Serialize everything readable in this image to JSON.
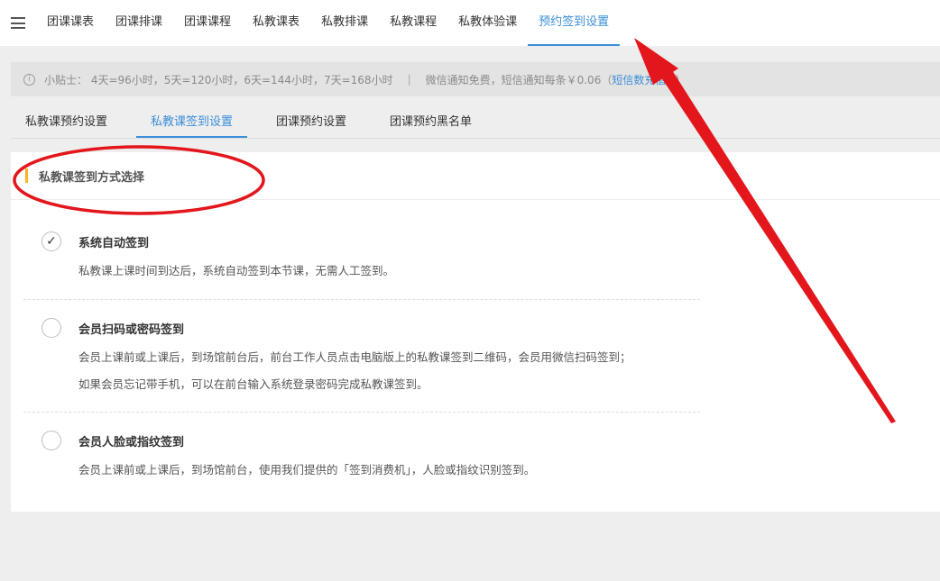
{
  "topnav": {
    "menu_icon": "hamburger-menu-icon",
    "tabs": [
      {
        "label": "团课课表"
      },
      {
        "label": "团课排课"
      },
      {
        "label": "团课课程"
      },
      {
        "label": "私教课表"
      },
      {
        "label": "私教排课"
      },
      {
        "label": "私教课程"
      },
      {
        "label": "私教体验课"
      },
      {
        "label": "预约签到设置",
        "active": true
      }
    ]
  },
  "tipbar": {
    "icon": "info-icon",
    "hours_text": "小贴士：  4天=96小时，5天=120小时，6天=144小时，7天=168小时",
    "separator": "|",
    "notice_text": "微信通知免费，短信通知每条￥0.06（",
    "link_text": "短信数充值→",
    "close_paren": "）"
  },
  "subtabs": [
    {
      "label": "私教课预约设置"
    },
    {
      "label": "私教课签到设置",
      "active": true
    },
    {
      "label": "团课预约设置"
    },
    {
      "label": "团课预约黑名单"
    }
  ],
  "section": {
    "title": "私教课签到方式选择"
  },
  "options": [
    {
      "title": "系统自动签到",
      "checked": true,
      "check_mark": "✓",
      "desc": [
        "私教课上课时间到达后，系统自动签到本节课，无需人工签到。"
      ]
    },
    {
      "title": "会员扫码或密码签到",
      "checked": false,
      "desc": [
        "会员上课前或上课后，到场馆前台后，前台工作人员点击电脑版上的私教课签到二维码，会员用微信扫码签到；",
        "如果会员忘记带手机，可以在前台输入系统登录密码完成私教课签到。"
      ]
    },
    {
      "title": "会员人脸或指纹签到",
      "checked": false,
      "desc": [
        "会员上课前或上课后，到场馆前台，使用我们提供的「签到消费机」，人脸或指纹识别签到。"
      ]
    }
  ],
  "colors": {
    "accent": "#3a8fd8",
    "section_bar": "#f5b621",
    "annotation": "#e3161b"
  }
}
